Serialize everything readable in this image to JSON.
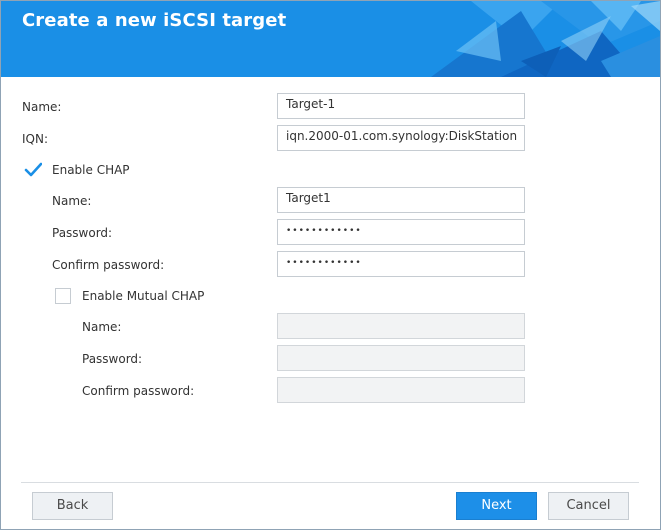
{
  "dialog": {
    "title": "Create a new iSCSI target"
  },
  "target": {
    "name_label": "Name:",
    "name_value": "Target-1",
    "iqn_label": "IQN:",
    "iqn_value": "iqn.2000-01.com.synology:DiskStation"
  },
  "chap": {
    "enable_label": "Enable CHAP",
    "enabled": true,
    "name_label": "Name:",
    "name_value": "Target1",
    "password_label": "Password:",
    "password_value": "••••••••••••",
    "confirm_label": "Confirm password:",
    "confirm_value": "••••••••••••"
  },
  "mutual_chap": {
    "enable_label": "Enable Mutual CHAP",
    "enabled": false,
    "name_label": "Name:",
    "password_label": "Password:",
    "confirm_label": "Confirm password:"
  },
  "footer": {
    "back_label": "Back",
    "next_label": "Next",
    "cancel_label": "Cancel"
  },
  "colors": {
    "header": "#1a8fe6",
    "primary_button": "#1d8fe8",
    "checkmark": "#1a8fe6"
  }
}
